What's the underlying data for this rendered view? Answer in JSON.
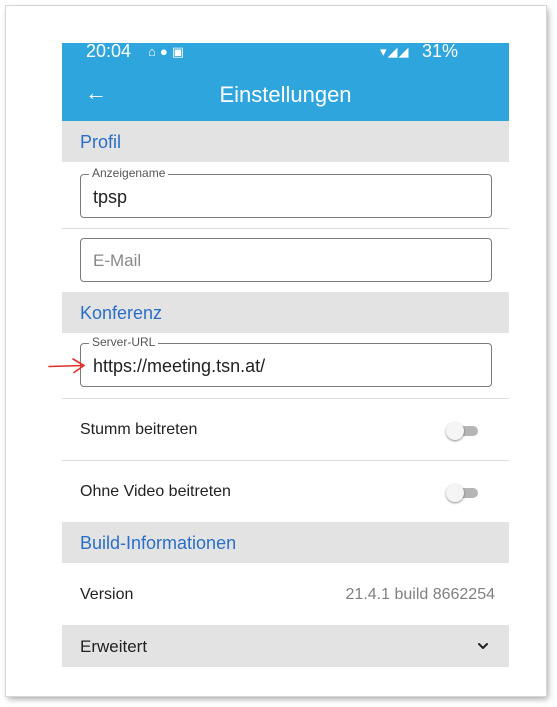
{
  "status_bar": {
    "time": "20:04",
    "left_icons": [
      "home-icon",
      "circle-icon",
      "image-icon"
    ],
    "battery": "31%"
  },
  "app_bar": {
    "title": "Einstellungen",
    "back_icon": "arrow-back-icon"
  },
  "sections": {
    "profil": "Profil",
    "konferenz": "Konferenz",
    "build": "Build-Informationen"
  },
  "fields": {
    "display_name": {
      "label": "Anzeigename",
      "value": "tpsp"
    },
    "email": {
      "placeholder": "E-Mail"
    },
    "server_url": {
      "label": "Server-URL",
      "value": "https://meeting.tsn.at/"
    }
  },
  "toggles": {
    "mute": {
      "label": "Stumm beitreten",
      "on": false
    },
    "no_video": {
      "label": "Ohne Video beitreten",
      "on": false
    }
  },
  "version": {
    "label": "Version",
    "value": "21.4.1 build 8662254"
  },
  "advanced": {
    "label": "Erweitert",
    "icon": "chevron-down-icon"
  },
  "annotation": {
    "icon": "red-arrow-icon",
    "color": "#e0302a"
  },
  "colors": {
    "accent": "#2ea5dc",
    "section_text": "#2a6fc6",
    "section_bg": "#e3e3e3"
  }
}
